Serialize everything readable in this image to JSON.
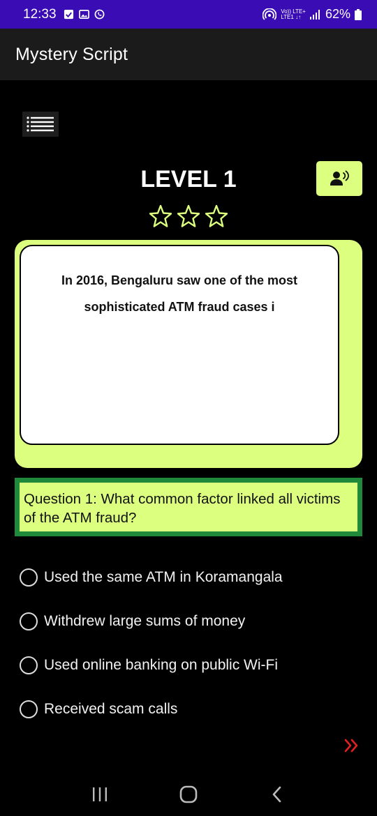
{
  "status_bar": {
    "time": "12:33",
    "network_top": "Vo)) LTE+",
    "network_bottom": "LTE1 ↓↑",
    "battery": "62%",
    "left_icons": [
      "check-icon",
      "image-icon",
      "whatsapp-icon"
    ],
    "right_icons": [
      "hotspot-icon",
      "signal-icon",
      "battery-icon"
    ],
    "color": "#3a0cb4"
  },
  "app_bar": {
    "title": "Mystery Script",
    "color": "#1b1b1b"
  },
  "menu": {
    "icon": "menu-icon"
  },
  "level": {
    "title": "LEVEL 1",
    "stars_total": 3,
    "stars_filled": 0,
    "speaker_icon": "voice-speaker-icon"
  },
  "story": {
    "line1": "In 2016, Bengaluru saw one of the most",
    "line2": "sophisticated ATM fraud cases i"
  },
  "question": {
    "text": "Question 1: What common factor linked all victims of the ATM fraud?"
  },
  "options": [
    {
      "label": "Used the same ATM in Koramangala",
      "selected": false
    },
    {
      "label": "Withdrew large sums of money",
      "selected": false
    },
    {
      "label": "Used online banking on public Wi-Fi",
      "selected": false
    },
    {
      "label": "Received scam calls",
      "selected": false
    }
  ],
  "next": {
    "icon": "double-chevron-right-icon",
    "color": "#e02020"
  },
  "colors": {
    "accent": "#dcff80",
    "question_border": "#1f8a3a",
    "background": "#000000"
  },
  "nav_bar": {
    "buttons": [
      "recents-icon",
      "home-icon",
      "back-icon"
    ]
  }
}
